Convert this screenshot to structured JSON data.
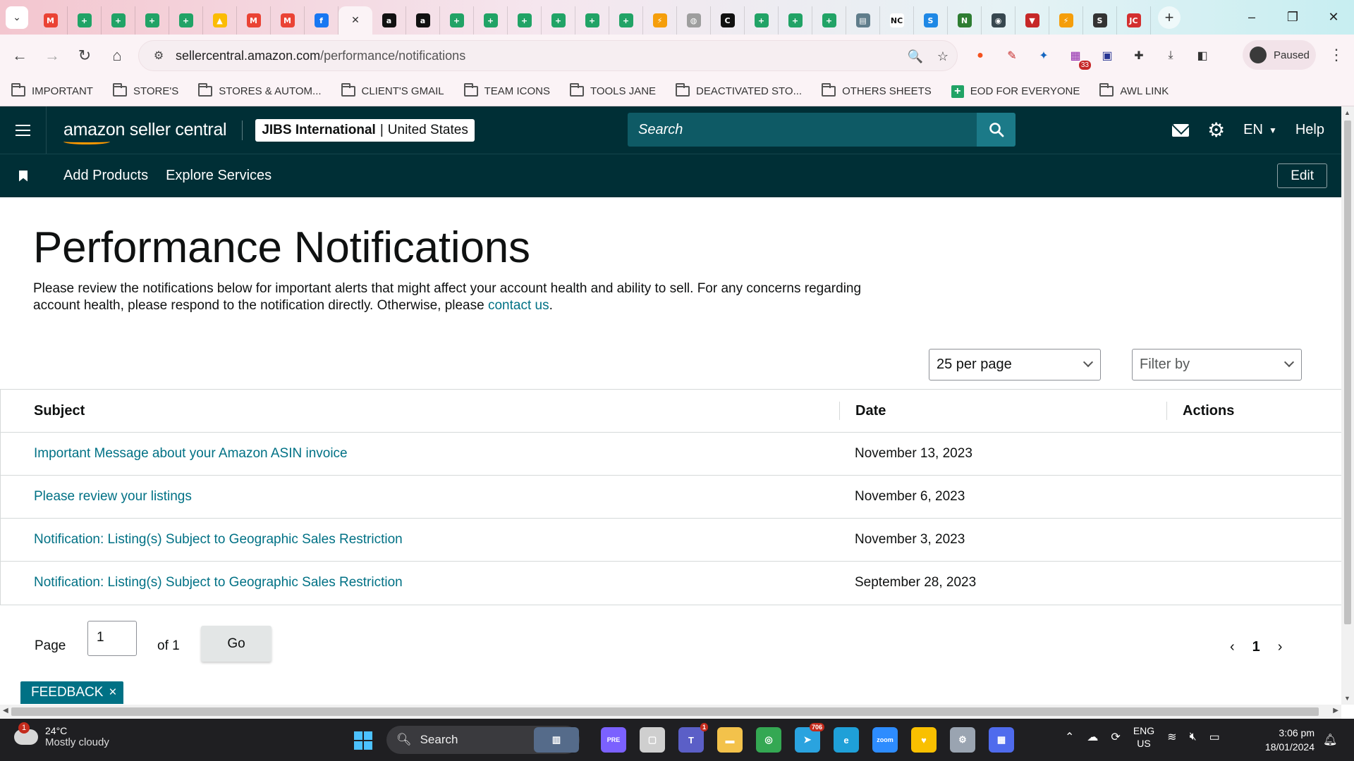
{
  "browser": {
    "tabs": [
      {
        "icon": "tab-overflow-icon"
      },
      {
        "icon": "gmail-icon",
        "color": "#ea4335"
      },
      {
        "icon": "sheets-icon",
        "color": "#21a366"
      },
      {
        "icon": "sheets-icon",
        "color": "#21a366"
      },
      {
        "icon": "sheets-icon",
        "color": "#21a366"
      },
      {
        "icon": "sheets-icon",
        "color": "#21a366"
      },
      {
        "icon": "drive-icon",
        "color": "#fbbc04"
      },
      {
        "icon": "gmail-icon",
        "color": "#ea4335"
      },
      {
        "icon": "gmail-icon",
        "color": "#ea4335"
      },
      {
        "icon": "facebook-icon",
        "color": "#1877f2"
      },
      {
        "icon": "close-icon",
        "active": true
      },
      {
        "icon": "amazon-icon",
        "color": "#111111"
      },
      {
        "icon": "amazon-icon",
        "color": "#111111"
      },
      {
        "icon": "sheets-icon",
        "color": "#21a366"
      },
      {
        "icon": "sheets-icon",
        "color": "#21a366"
      },
      {
        "icon": "sheets-icon",
        "color": "#21a366"
      },
      {
        "icon": "sheets-icon",
        "color": "#21a366"
      },
      {
        "icon": "sheets-icon",
        "color": "#21a366"
      },
      {
        "icon": "sheets-icon",
        "color": "#21a366"
      },
      {
        "icon": "stripe-icon",
        "color": "#f59e0b"
      },
      {
        "icon": "globe-icon",
        "color": "#9e9e9e"
      },
      {
        "icon": "c-icon",
        "color": "#111111"
      },
      {
        "icon": "sheets-icon",
        "color": "#21a366"
      },
      {
        "icon": "sheets-icon",
        "color": "#21a366"
      },
      {
        "icon": "sheets-icon",
        "color": "#21a366"
      },
      {
        "icon": "truck-icon",
        "color": "#607d8b"
      },
      {
        "icon": "nc-icon",
        "color": "#111111",
        "text": "NC"
      },
      {
        "icon": "sysco-icon",
        "color": "#1e88e5"
      },
      {
        "icon": "n-icon",
        "color": "#2e7d32"
      },
      {
        "icon": "seal-icon",
        "color": "#37474f"
      },
      {
        "icon": "shield-icon",
        "color": "#c62828"
      },
      {
        "icon": "stripe-icon",
        "color": "#f59e0b"
      },
      {
        "icon": "sam-icon",
        "color": "#333333"
      },
      {
        "icon": "jc-icon",
        "color": "#d32f2f"
      }
    ],
    "window_controls": {
      "minimize": "–",
      "restore": "❐",
      "close": "✕"
    },
    "url_host": "sellercentral.amazon.com",
    "url_path": "/performance/notifications",
    "profile_label": "Paused",
    "extension_badge": "33",
    "bookmarks": [
      {
        "label": "IMPORTANT",
        "icon": "folder-icon"
      },
      {
        "label": "STORE'S",
        "icon": "folder-icon"
      },
      {
        "label": "STORES & AUTOM...",
        "icon": "folder-icon"
      },
      {
        "label": "CLIENT'S GMAIL",
        "icon": "folder-icon"
      },
      {
        "label": "TEAM ICONS",
        "icon": "folder-icon"
      },
      {
        "label": "TOOLS JANE",
        "icon": "folder-icon"
      },
      {
        "label": "DEACTIVATED STO...",
        "icon": "folder-icon"
      },
      {
        "label": "OTHERS SHEETS",
        "icon": "folder-icon"
      },
      {
        "label": "EOD FOR EVERYONE",
        "icon": "sheets-icon"
      },
      {
        "label": "AWL LINK",
        "icon": "folder-icon"
      }
    ]
  },
  "header": {
    "logo_text": "amazon seller central",
    "account_name": "JIBS International",
    "account_sep": "|",
    "marketplace": "United States",
    "search_placeholder": "Search",
    "language": "EN",
    "help": "Help"
  },
  "nav": {
    "links": [
      "Add Products",
      "Explore Services"
    ],
    "edit": "Edit"
  },
  "page": {
    "title": "Performance Notifications",
    "intro_text": "Please review the notifications below for important alerts that might affect your account health and ability to sell. For any concerns regarding account health, please respond to the notification directly. Otherwise, please ",
    "intro_link": "contact us",
    "intro_end": ".",
    "per_page": "25 per page",
    "filter_placeholder": "Filter by"
  },
  "table": {
    "columns": {
      "subject": "Subject",
      "date": "Date",
      "actions": "Actions"
    },
    "rows": [
      {
        "subject": "Important Message about your Amazon ASIN invoice",
        "date": "November 13, 2023"
      },
      {
        "subject": "Please review your listings",
        "date": "November 6, 2023"
      },
      {
        "subject": "Notification: Listing(s) Subject to Geographic Sales Restriction",
        "date": "November 3, 2023"
      },
      {
        "subject": "Notification: Listing(s) Subject to Geographic Sales Restriction",
        "date": "September 28, 2023"
      }
    ]
  },
  "pagination": {
    "page_label": "Page",
    "page_value": "1",
    "of_label": "of 1",
    "go": "Go",
    "current": "1"
  },
  "feedback": {
    "label": "FEEDBACK",
    "close": "×"
  },
  "taskbar": {
    "weather_badge": "1",
    "temperature": "24°C",
    "weather": "Mostly cloudy",
    "search": "Search",
    "apps": [
      {
        "icon": "city-widget-icon",
        "color": "#556b8a"
      },
      {
        "icon": "copilot-icon",
        "color": "#7b61ff",
        "text": "PRE"
      },
      {
        "icon": "task-view-icon",
        "color": "#cfcfcf"
      },
      {
        "icon": "teams-icon",
        "color": "#5b5fc7",
        "badge": "1"
      },
      {
        "icon": "file-explorer-icon",
        "color": "#f3c24b"
      },
      {
        "icon": "chrome-icon",
        "color": "#34a853"
      },
      {
        "icon": "telegram-icon",
        "color": "#2aa3df",
        "badge": "706"
      },
      {
        "icon": "edge-icon",
        "color": "#1fa0d8"
      },
      {
        "icon": "zoom-icon",
        "color": "#2d8cff",
        "text": "zoom"
      },
      {
        "icon": "vpn-icon",
        "color": "#f9c000"
      },
      {
        "icon": "settings-icon",
        "color": "#9aa4b1"
      },
      {
        "icon": "calculator-icon",
        "color": "#4f6bed"
      }
    ],
    "lang_line1": "ENG",
    "lang_line2": "US",
    "time": "3:06 pm",
    "date": "18/01/2024"
  }
}
